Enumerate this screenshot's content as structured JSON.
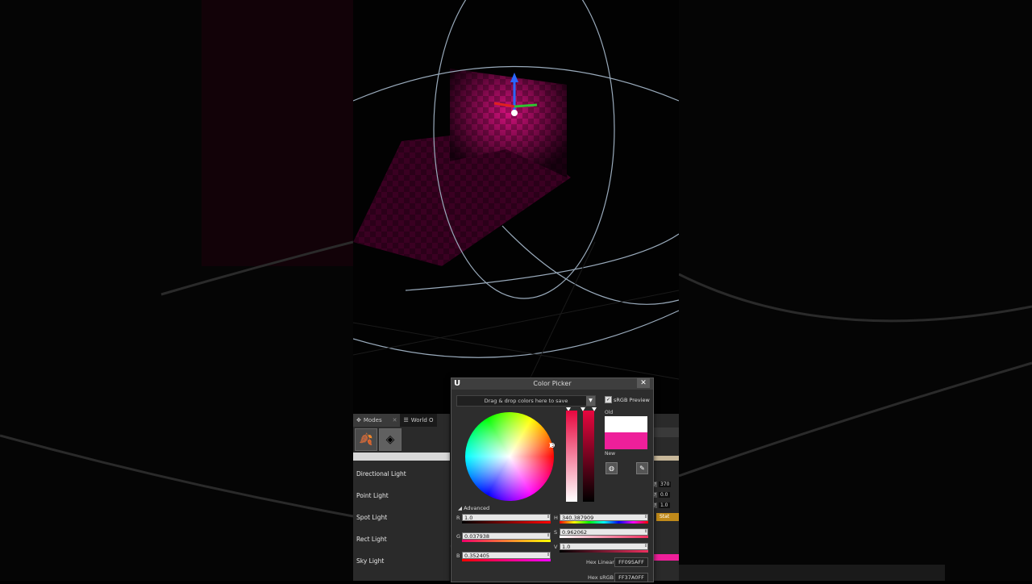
{
  "colors": {
    "accent": "#ee1f9a",
    "slider": "#e8073f",
    "window_bg": "#2d2d2d"
  },
  "modes_panel": {
    "tabs": [
      {
        "label": "Modes",
        "icon": "modes-icon"
      },
      {
        "label": "World O",
        "icon": "world-outliner-icon"
      }
    ],
    "mode_buttons": [
      {
        "icon": "foliage-brush-icon"
      },
      {
        "icon": "place-actor-cube-icon"
      }
    ],
    "lights": [
      "Directional Light",
      "Point Light",
      "Spot Light",
      "Rect Light",
      "Sky Light"
    ]
  },
  "right_panel": {
    "values": [
      "370",
      "0.0",
      "1.0"
    ],
    "badge": "Stat"
  },
  "color_picker": {
    "title": "Color Picker",
    "close_glyph": "✕",
    "drop_text": "Drag & drop colors here to save",
    "srgb_label": "sRGB Preview",
    "srgb_checked": true,
    "old_label": "Old",
    "new_label": "New",
    "old_color": "#ffffff",
    "new_color": "#ee1f9a",
    "advanced_label": "Advanced",
    "fields": {
      "R": {
        "label": "R",
        "value": "1.0"
      },
      "G": {
        "label": "G",
        "value": "0.037938"
      },
      "B": {
        "label": "B",
        "value": "0.352405"
      },
      "H": {
        "label": "H",
        "value": "340.387909"
      },
      "S": {
        "label": "S",
        "value": "0.962062"
      },
      "V": {
        "label": "V",
        "value": "1.0"
      }
    },
    "hex_linear_label": "Hex Linear",
    "hex_linear": "FF095AFF",
    "hex_srgb_label": "Hex sRGB",
    "hex_srgb": "FF37A0FF"
  }
}
